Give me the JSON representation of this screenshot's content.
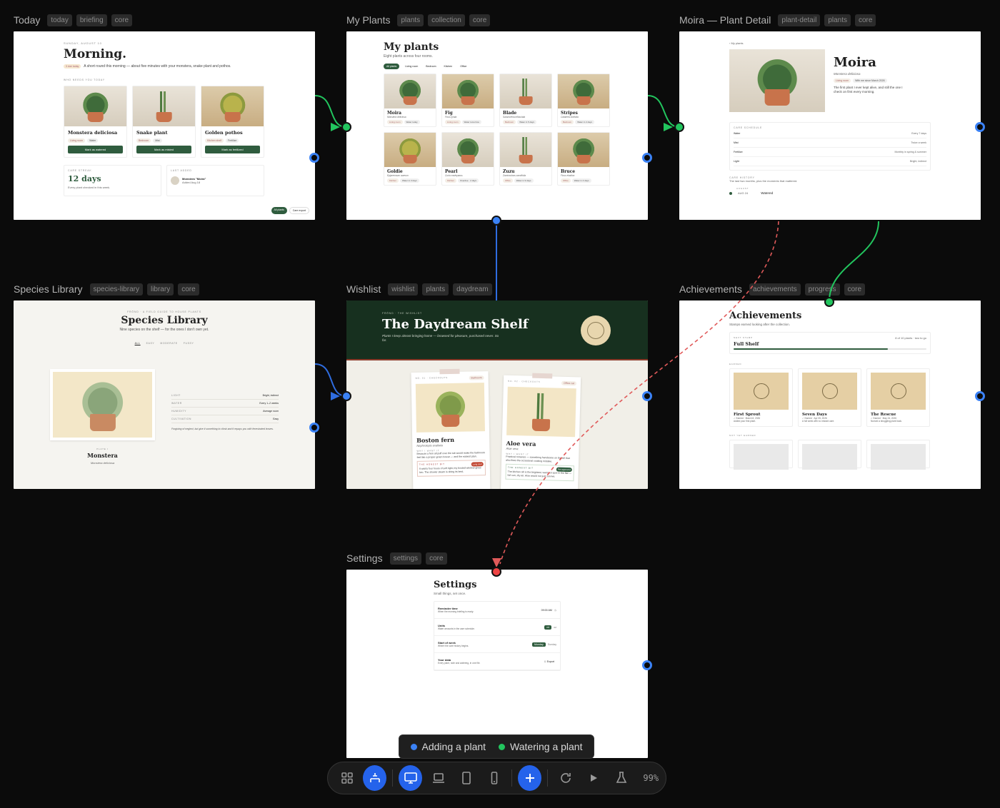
{
  "frames": {
    "today": {
      "title": "Today",
      "tags": [
        "today",
        "briefing",
        "core"
      ],
      "kicker": "SUNDAY, AUGUST 10",
      "heading": "Morning.",
      "badge": "3 due today",
      "summary": "A short round this morning — about five minutes with your monstera, snake plant and pothos.",
      "section": "WHO NEEDS YOU TODAY",
      "plants": [
        {
          "name": "Monstera deliciosa",
          "room": "Living room",
          "task": "Water",
          "button": "Mark as watered"
        },
        {
          "name": "Snake plant",
          "room": "Bedroom",
          "task": "Mist",
          "button": "Mark as misted"
        },
        {
          "name": "Golden pothos",
          "room": "Kitchen shelf",
          "task": "Fertilize",
          "button": "Mark as fertilized"
        }
      ],
      "streak_label": "CARE STREAK",
      "streak_value": "12 days",
      "streak_note": "Every plant checked in this week.",
      "last_added_label": "LAST ADDED",
      "last_added_name": "Monstera \"Moira\"",
      "last_added_date": "Added Aug 18",
      "btn_all": "All plants",
      "btn_export": "Care export"
    },
    "myplants": {
      "title": "My Plants",
      "tags": [
        "plants",
        "collection",
        "core"
      ],
      "heading": "My plants",
      "sub": "Eight plants across four rooms.",
      "filters": [
        "All plants",
        "Living room",
        "Bedroom",
        "Kitchen",
        "Office"
      ],
      "plants": [
        {
          "name": "Moira",
          "species": "Monstera deliciosa",
          "room": "Living room",
          "water": "Water today"
        },
        {
          "name": "Fig",
          "species": "Ficus lyrata",
          "room": "Living room",
          "water": "Water tomorrow"
        },
        {
          "name": "Blade",
          "species": "Sansevieria trifasciata",
          "room": "Bedroom",
          "water": "Water in 5 days"
        },
        {
          "name": "Stripes",
          "species": "Calathea orbifolia",
          "room": "Bedroom",
          "water": "Water in 2 days"
        },
        {
          "name": "Goldie",
          "species": "Epipremnum aureum",
          "room": "Kitchen",
          "water": "Water in 3 days"
        },
        {
          "name": "Pearl",
          "species": "Curio rowleyanus",
          "room": "Kitchen",
          "water": "Overdue · 2 days"
        },
        {
          "name": "Zuzu",
          "species": "Zamioculcas zamiifolia",
          "room": "Office",
          "water": "Water in 9 days"
        },
        {
          "name": "Bruce",
          "species": "Ficus elastica",
          "room": "Office",
          "water": "Water in 4 days"
        }
      ]
    },
    "detail": {
      "title": "Moira — Plant Detail",
      "tags": [
        "plant-detail",
        "plants",
        "core"
      ],
      "back": "‹ My plants",
      "heading": "Moira",
      "species": "Monstera deliciosa",
      "chips": [
        "Living room",
        "With me since March 2026"
      ],
      "note": "The first plant I ever kept alive, and still the one I check on first every morning.",
      "schedule_label": "CARE SCHEDULE",
      "schedule": [
        {
          "task": "Water",
          "value": "Every 7 days"
        },
        {
          "task": "Mist",
          "value": "Twice a week"
        },
        {
          "task": "Fertilize",
          "value": "Monthly in spring & summer"
        },
        {
          "task": "Light",
          "value": "Bright, indirect"
        }
      ],
      "history_label": "CARE HISTORY",
      "history_sub": "The last two months, plus the moments that mattered.",
      "history_month": "AUGUST",
      "history_date": "AUG 24",
      "history_item": "Watered"
    },
    "species": {
      "title": "Species Library",
      "tags": [
        "species-library",
        "library",
        "core"
      ],
      "kicker": "FRŌND · A FIELD GUIDE TO HOUSE PLANTS",
      "heading": "Species Library",
      "sub": "Nine species on the shelf — for the ones I don't own yet.",
      "filters": [
        "ALL",
        "EASY",
        "MODERATE",
        "FUSSY"
      ],
      "plate": "PLATE I",
      "name": "Monstera",
      "latin": "Monstera deliciosa",
      "facts": [
        {
          "k": "LIGHT",
          "v": "Bright, indirect"
        },
        {
          "k": "WATER",
          "v": "Every 1–2 weeks"
        },
        {
          "k": "HUMIDITY",
          "v": "Average room"
        },
        {
          "k": "CULTIVATION",
          "v": "Easy"
        }
      ],
      "desc": "Forgiving of neglect, but give it something to climb and it repays you with fenestrated leaves."
    },
    "wishlist": {
      "title": "Wishlist",
      "tags": [
        "wishlist",
        "plants",
        "daydream"
      ],
      "kicker": "FRŌND · THE WISHLIST",
      "heading": "The Daydream Shelf",
      "sub": "Plants I keep almost bringing home — browsed for pleasure, purchased never. So far.",
      "cards": [
        {
          "no": "NO. 01 · CHECKOUTS",
          "badge": "Bathroom",
          "name": "Boston fern",
          "latin": "Nephrolepis exaltata",
          "why_label": "WHY I WANT IT",
          "why": "Because a fern all puff over the tub would make the bathroom feel like a proper green house — and the easiest plan.",
          "honest_label": "THE HONEST BIT",
          "honest_badge": "Long shot",
          "honest": "It wants four hours of soft light; my frosted window gives two. The shower steam is doing its best."
        },
        {
          "no": "NO. 02 · CHECKOUTS",
          "badge": "Office cat",
          "name": "Aloe vera",
          "latin": "Aloe vera",
          "why_label": "WHY I WANT IT",
          "why": "Practical romance — something handsome on the sill that also fixes the occasional cooking mistake.",
          "honest_label": "THE HONEST BIT",
          "honest_badge": "Pet approved",
          "honest": "The kitchen sill is the brightest, warmest spot in the flat — full sun, dry air. Aloe would not just survive."
        }
      ]
    },
    "achievements": {
      "title": "Achievements",
      "tags": [
        "achievements",
        "progress",
        "core"
      ],
      "heading": "Achievements",
      "sub": "Stamps earned looking after the collection.",
      "next_label": "NEXT STAMP",
      "next_name": "Full Shelf",
      "next_progress_text": "8 of 10 plants · two to go",
      "progress": 0.8,
      "earned_label": "EARNED",
      "earned": [
        {
          "name": "First Sprout",
          "meta": "✓ Earned · March 8, 2026",
          "note": "Added your first plant."
        },
        {
          "name": "Seven Days",
          "meta": "✓ Earned · Apr 05, 2026",
          "note": "A full week with no missed care."
        },
        {
          "name": "The Rescue",
          "meta": "✓ Earned · May 24, 2026",
          "note": "Nursed a struggling plant back."
        }
      ],
      "locked_label": "NOT YET EARNED"
    },
    "settings": {
      "title": "Settings",
      "tags": [
        "settings",
        "core"
      ],
      "heading": "Settings",
      "sub": "Small things, set once.",
      "rows": [
        {
          "label": "Reminder time",
          "note": "When the morning briefing is ready.",
          "value": "09:00 AM",
          "extra": "◷"
        },
        {
          "label": "Units",
          "note": "Water amounts in the care schedule.",
          "value": "ml",
          "extra": "oz"
        },
        {
          "label": "Start of week",
          "note": "Where the care history begins.",
          "value": "Monday",
          "extra": "Sunday"
        },
        {
          "label": "Your data",
          "note": "Every plant, note and watering, in one file.",
          "value": "⇩ Export",
          "extra": ""
        }
      ]
    }
  },
  "legend": [
    {
      "label": "Adding a plant",
      "color": "#3b82f6"
    },
    {
      "label": "Watering a plant",
      "color": "#22c55e"
    }
  ],
  "toolbar": {
    "icons": [
      "grid-icon",
      "flow-icon",
      "desktop-icon",
      "laptop-icon",
      "tablet-icon",
      "phone-icon",
      "add-icon",
      "refresh-icon",
      "play-icon",
      "beaker-icon"
    ],
    "zoom": "99%"
  }
}
